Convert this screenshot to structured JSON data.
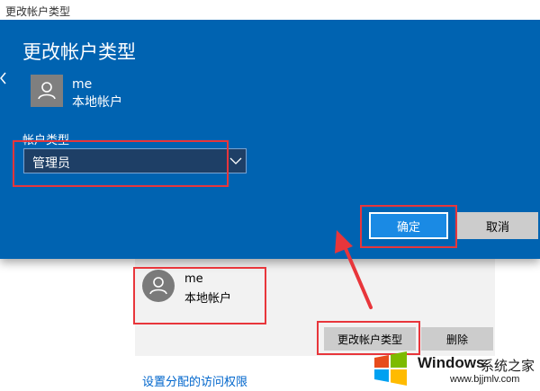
{
  "window": {
    "title": "更改帐户类型"
  },
  "dialog": {
    "heading": "更改帐户类型",
    "user": {
      "name": "me",
      "type": "本地帐户"
    },
    "account_type_label": "帐户类型",
    "account_type_selected": "管理员",
    "ok_label": "确定",
    "cancel_label": "取消"
  },
  "background": {
    "user": {
      "name": "me",
      "type": "本地帐户"
    },
    "change_type_label": "更改帐户类型",
    "delete_label": "删除",
    "access_link": "设置分配的访问权限"
  },
  "watermark": {
    "brand": "Windows",
    "subtitle": "系统之家",
    "url": "www.bjjmlv.com"
  },
  "colors": {
    "dialog_background": "#0063b1",
    "select_background": "#1e3f66",
    "ok_button": "#1a8ae4",
    "annotation_red": "#e8363b",
    "link": "#0066cc"
  },
  "icons": {
    "user": "person-icon",
    "dropdown": "chevron-down-icon",
    "logo": "windows-logo-icon"
  }
}
